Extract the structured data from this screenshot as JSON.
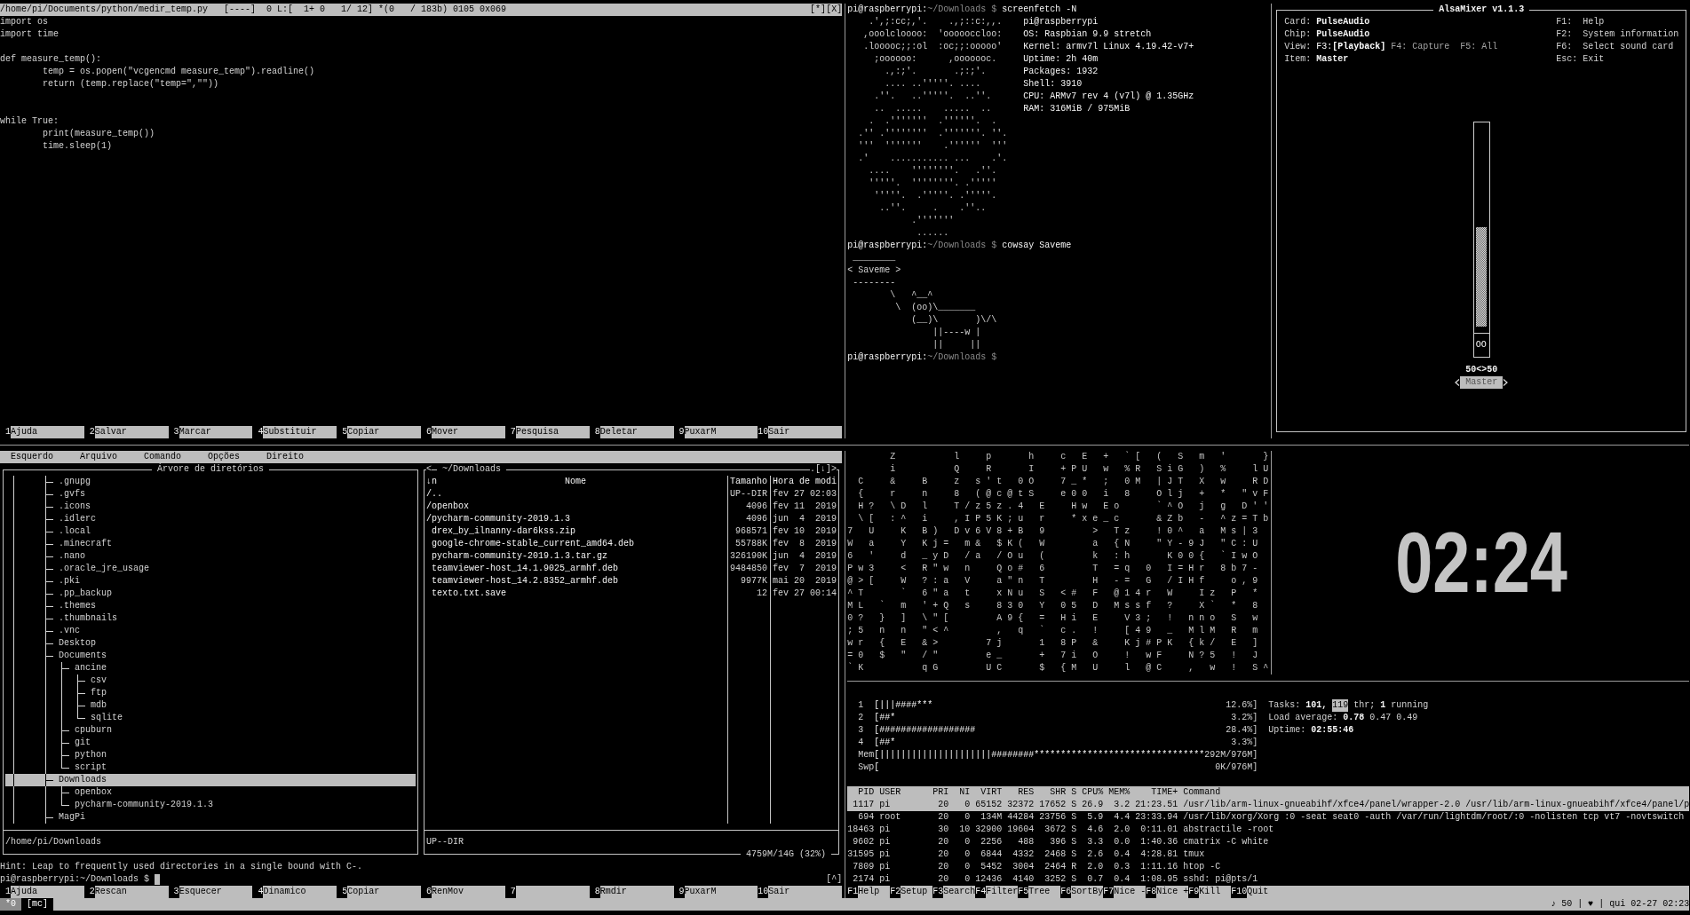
{
  "editor": {
    "file_path": "/home/pi/Documents/python/medir_temp.py",
    "status": "[----]  0 L:[  1+ 0   1/ 12] *(0   / 183b) 0105 0x069",
    "window_buttons": [
      "[*]",
      "[X]"
    ],
    "code": "import os\nimport time\n\ndef measure_temp():\n        temp = os.popen(\"vcgencmd measure_temp\").readline()\n        return (temp.replace(\"temp=\",\"\"))\n\n\nwhile True:\n        print(measure_temp())\n        time.sleep(1)",
    "function_keys": [
      {
        "key": "1",
        "label": "Ajuda"
      },
      {
        "key": "2",
        "label": "Salvar"
      },
      {
        "key": "3",
        "label": "Marcar"
      },
      {
        "key": "4",
        "label": "Substituir"
      },
      {
        "key": "5",
        "label": "Copiar"
      },
      {
        "key": "6",
        "label": "Mover"
      },
      {
        "key": "7",
        "label": "Pesquisa"
      },
      {
        "key": "8",
        "label": "Deletar"
      },
      {
        "key": "9",
        "label": "PuxarM"
      },
      {
        "key": "10",
        "label": "Sair"
      }
    ]
  },
  "shell": {
    "blocks": [
      {
        "kind": "prompt",
        "host": "pi@raspberrypi:",
        "path": "~/Downloads $",
        "command": "screenfetch -N"
      },
      {
        "kind": "screenfetch",
        "logo": "    .',;:cc;,'.    .,;::c:,,.\n   ,ooolcloooo:  'oooooccloo:\n   .looooc;;:ol  :oc;;:ooooo'\n     ;oooooo:      ,ooooooc.\n       .,:;'.       .;:;'.\n       .... ..'''''. ....\n     .''.   ..'''''.  ..''.\n     ..  .....    .....  ..\n    .  .'''''''  .''''''.  .\n  .'' .''''''''  .'''''''. ''.\n  '''  '''''''    .''''''  '''\n  .'    ........... ...    .'.\n    ....    ''''''''.   .''.\n    '''''.  ''''''''. .'''''\n     '''''.  .'''''. .'''''.\n      ..''.     .    .''..\n            .'''''''\n             ......",
        "info": [
          "pi@raspberrypi",
          "OS: Raspbian 9.9 stretch",
          "Kernel: armv7l Linux 4.19.42-v7+",
          "Uptime: 2h 40m",
          "Packages: 1932",
          "Shell: 3910",
          "CPU: ARMv7 rev 4 (v7l) @ 1.35GHz",
          "RAM: 316MiB / 975MiB"
        ]
      },
      {
        "kind": "prompt",
        "host": "pi@raspberrypi:",
        "path": "~/Downloads $",
        "command": "cowsay Saveme"
      },
      {
        "kind": "cowsay",
        "text": " ________\n< Saveme >\n --------\n        \\   ^__^\n         \\  (oo)\\_______\n            (__)\\       )\\/\\\n                ||----w |\n                ||     ||"
      },
      {
        "kind": "prompt",
        "host": "pi@raspberrypi:",
        "path": "~/Downloads $"
      }
    ]
  },
  "mixer": {
    "title": "AlsaMixer v1.1.3",
    "info": [
      {
        "kind": "value",
        "label": "Card:",
        "value": "PulseAudio"
      },
      {
        "kind": "value",
        "label": "Chip:",
        "value": "PulseAudio"
      },
      {
        "kind": "views",
        "label": "View:",
        "options": [
          {
            "key": "F3:",
            "label": "[Playback]",
            "selected": true
          },
          {
            "key": "F4:",
            "label": "Capture",
            "selected": false
          },
          {
            "key": "F5:",
            "label": "All",
            "selected": false
          }
        ]
      },
      {
        "kind": "value",
        "label": "Item:",
        "value": "Master"
      }
    ],
    "shortcuts": [
      {
        "key": "F1:",
        "label": "Help"
      },
      {
        "key": "F2:",
        "label": "System information"
      },
      {
        "key": "F6:",
        "label": "Select sound card"
      },
      {
        "key": "Esc:",
        "label": "Exit"
      }
    ],
    "channels": [
      {
        "name": "Master",
        "level": 0.5,
        "switch": "OO",
        "reading": "50<>50",
        "selected": true
      }
    ]
  },
  "file_manager": {
    "menu": [
      "Esquerdo",
      "Arquivo",
      "Comando",
      "Opções",
      "Direito"
    ],
    "left_panel": {
      "title": "Árvore de diretórios",
      "tree": [
        {
          "label": ".gnupg",
          "selected": false
        },
        {
          "label": ".gvfs",
          "selected": false
        },
        {
          "label": ".icons",
          "selected": false
        },
        {
          "label": ".idlerc",
          "selected": false
        },
        {
          "label": ".local",
          "selected": false
        },
        {
          "label": ".minecraft",
          "selected": false
        },
        {
          "label": ".nano",
          "selected": false
        },
        {
          "label": ".oracle_jre_usage",
          "selected": false
        },
        {
          "label": ".pki",
          "selected": false
        },
        {
          "label": ".pp_backup",
          "selected": false
        },
        {
          "label": ".themes",
          "selected": false
        },
        {
          "label": ".thumbnails",
          "selected": false
        },
        {
          "label": ".vnc",
          "selected": false
        },
        {
          "label": "Desktop",
          "selected": false
        },
        {
          "label": "Documents",
          "selected": false,
          "children": [
            {
              "label": "ancine",
              "selected": false,
              "children": [
                {
                  "label": "csv",
                  "selected": false
                },
                {
                  "label": "ftp",
                  "selected": false
                },
                {
                  "label": "mdb",
                  "selected": false
                },
                {
                  "label": "sqlite",
                  "selected": false
                }
              ]
            },
            {
              "label": "cpuburn",
              "selected": false
            },
            {
              "label": "git",
              "selected": false
            },
            {
              "label": "python",
              "selected": false
            },
            {
              "label": "script",
              "selected": false
            }
          ]
        },
        {
          "label": "Downloads",
          "selected": true,
          "children": [
            {
              "label": "openbox",
              "selected": false
            },
            {
              "label": "pycharm-community-2019.1.3",
              "selected": false
            }
          ]
        },
        {
          "label": "MagPi",
          "selected": false
        }
      ],
      "path": "/home/pi/Downloads"
    },
    "right_panel": {
      "left_corner": "<",
      "title": "~/Downloads",
      "right_corner": ".[↓]>",
      "sort_indicator": "↓n",
      "columns": [
        "Nome",
        "Tamanho",
        "Hora de modi"
      ],
      "files": [
        {
          "kind": "dir",
          "name": "/..",
          "size": "UP--DIR",
          "modified": "fev 27 02:03"
        },
        {
          "kind": "dir",
          "name": "/openbox",
          "size": "4096",
          "modified": "fev 11  2019"
        },
        {
          "kind": "dir",
          "name": "/pycharm-community-2019.1.3",
          "size": "4096",
          "modified": "jun  4  2019"
        },
        {
          "kind": "file",
          "name": "drex_by_ilnanny-dar6kss.zip",
          "size": "968571",
          "modified": "fev 10  2019"
        },
        {
          "kind": "file",
          "name": "google-chrome-stable_current_amd64.deb",
          "size": "55788K",
          "modified": "fev  8  2019"
        },
        {
          "kind": "file",
          "name": "pycharm-community-2019.1.3.tar.gz",
          "size": "326190K",
          "modified": "jun  4  2019"
        },
        {
          "kind": "file",
          "name": "teamviewer-host_14.1.9025_armhf.deb",
          "size": "9484850",
          "modified": "fev  7  2019"
        },
        {
          "kind": "file",
          "name": "teamviewer-host_14.2.8352_armhf.deb",
          "size": "9977K",
          "modified": "mai 20  2019"
        },
        {
          "kind": "file",
          "name": "texto.txt.save",
          "size": "12",
          "modified": "fev 27 00:14"
        }
      ],
      "info": "UP--DIR",
      "disk_usage": "4759M/14G (32%)"
    },
    "hint": "Hint: Leap to frequently used directories in a single bound with C-.",
    "prompt": "pi@raspberrypi:~/Downloads $",
    "hotlist": "[^]",
    "function_keys": [
      {
        "key": "1",
        "label": "Ajuda"
      },
      {
        "key": "2",
        "label": "Rescan"
      },
      {
        "key": "3",
        "label": "Esquecer"
      },
      {
        "key": "4",
        "label": "Dinamico"
      },
      {
        "key": "5",
        "label": "Copiar"
      },
      {
        "key": "6",
        "label": "RenMov"
      },
      {
        "key": "7"
      },
      {
        "key": "8",
        "label": "Rmdir"
      },
      {
        "key": "9",
        "label": "PuxarM"
      },
      {
        "key": "10",
        "label": "Sair"
      }
    ]
  },
  "matrix": {
    "rows": [
      "    Z     l  p   h  c E + `[ ( S m '   }",
      "    i     Q  R   I  +PU w %R SiG ) %  lU",
      " C  &  B  z s't 0O  7_* ; 0M |JT X w  RD",
      " {  r  n  8 (@c@tS  e00 i 8  Olj + * \"vF",
      " H? \\D l  T/z5z.4 E  Hw Eo   `^O j g D''",
      " \\[ :^ i  ,IP5K;u r  *xe_c   &Zb - ^z=Tb",
      "7 U  K B) Dv6V8+B 9    > Tz  !0^ a Ms|3",
      "W a  Y Kj= m& $K( W    a {N  \"Y-9J \"C:U",
      "6 '  d _yD /a /Ou (    k :h   K00{ `IwO",
      "Pw3  < R\"w n  Qo# 6    T =q 0 I=Hr 8b7-",
      "@>[  W ?:a V  a\"n T    H -= G /IHf  o,9",
      "^T   ` 6\"a t  xNu S <# F @14r W  Iz P *",
      "ML ` m '+Q s  830 Y 05 D Mssf ?  X` * 8",
      "0? } ] \\\"[    A9{ = Hi E  V3; ! nno S w",
      ";5 n n \"<^    , q ` c. !  [49 _ MlM R m",
      "wr { E &>    7j   1 8P &  Kj#PK {k/ E ]",
      "=0 $ \" /\"    e_   + 7i O  ! wF  N?5 ! J",
      "`K     qG    UC   $ {M U  l @C  , w ! S^"
    ]
  },
  "clock": {
    "time": "02:24"
  },
  "htop": {
    "meters": [
      {
        "label": "1",
        "bar": "[|||####***",
        "reading": "12.6%]"
      },
      {
        "label": "2",
        "bar": "[##*",
        "reading": "3.2%]"
      },
      {
        "label": "3",
        "bar": "[##################",
        "reading": "28.4%]"
      },
      {
        "label": "4",
        "bar": "[##*",
        "reading": "3.3%]"
      },
      {
        "label": "Mem",
        "bar": "[|||||||||||||||||||||########********************************",
        "reading": "292M/976M]"
      },
      {
        "label": "Swp",
        "bar": "[",
        "reading": "0K/976M]"
      }
    ],
    "tasks": {
      "label": "Tasks:",
      "count": "101,",
      "threads": "119",
      "threads_label": "thr;",
      "running": "1",
      "running_label": "running"
    },
    "load": {
      "label": "Load average:",
      "values": [
        "0.78",
        "0.47",
        "0.49"
      ]
    },
    "uptime": {
      "label": "Uptime:",
      "value": "02:55:46"
    },
    "columns": [
      "PID",
      "USER",
      "PRI",
      "NI",
      "VIRT",
      "RES",
      "SHR",
      "S",
      "CPU%",
      "MEM%",
      "TIME+",
      "Command"
    ],
    "processes": [
      {
        "selected": true,
        "cells": [
          "1117",
          "pi",
          "20",
          "0",
          "65152",
          "32372",
          "17652",
          "S",
          "26.9",
          "3.2",
          "21:23.51",
          "/usr/lib/arm-linux-gnueabihf/xfce4/panel/wrapper-2.0 /usr/lib/arm-linux-gnueabihf/xfce4/panel/p"
        ]
      },
      {
        "selected": false,
        "cells": [
          "694",
          "root",
          "20",
          "0",
          "134M",
          "44284",
          "23756",
          "S",
          "5.9",
          "4.4",
          "23:33.94",
          "/usr/lib/xorg/Xorg :0 -seat seat0 -auth /var/run/lightdm/root/:0 -nolisten tcp vt7 -novtswitch"
        ]
      },
      {
        "selected": false,
        "cells": [
          "18463",
          "pi",
          "30",
          "10",
          "32900",
          "19604",
          "3672",
          "S",
          "4.6",
          "2.0",
          "0:11.01",
          "abstractile -root"
        ]
      },
      {
        "selected": false,
        "cells": [
          "9602",
          "pi",
          "20",
          "0",
          "2256",
          "488",
          "396",
          "S",
          "3.3",
          "0.0",
          "1:40.36",
          "cmatrix -C white"
        ]
      },
      {
        "selected": false,
        "cells": [
          "31595",
          "pi",
          "20",
          "0",
          "6844",
          "4332",
          "2468",
          "S",
          "2.6",
          "0.4",
          "4:28.81",
          "tmux"
        ]
      },
      {
        "selected": false,
        "cells": [
          "7809",
          "pi",
          "20",
          "0",
          "5452",
          "3004",
          "2464",
          "R",
          "2.0",
          "0.3",
          "1:11.16",
          "htop -C"
        ]
      },
      {
        "selected": false,
        "cells": [
          "2174",
          "pi",
          "20",
          "0",
          "12436",
          "4140",
          "3252",
          "S",
          "0.7",
          "0.4",
          "1:08.95",
          "sshd: pi@pts/1"
        ]
      }
    ],
    "function_keys": [
      {
        "key": "F1",
        "label": "Help"
      },
      {
        "key": "F2",
        "label": "Setup"
      },
      {
        "key": "F3",
        "label": "Search"
      },
      {
        "key": "F4",
        "label": "Filter"
      },
      {
        "key": "F5",
        "label": "Tree"
      },
      {
        "key": "F6",
        "label": "SortBy"
      },
      {
        "key": "F7",
        "label": "Nice -"
      },
      {
        "key": "F8",
        "label": "Nice +"
      },
      {
        "key": "F9",
        "label": "Kill"
      },
      {
        "key": "F10",
        "label": "Quit"
      }
    ]
  },
  "status_bar": {
    "window_index": "*0",
    "window_name": "[mc]",
    "right": "♪ 50 | ♥ | qui 02-27 02:23"
  }
}
